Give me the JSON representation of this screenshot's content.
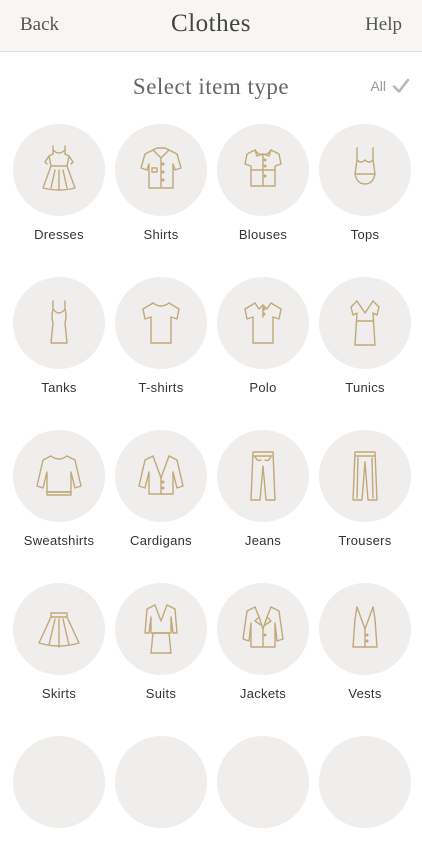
{
  "nav": {
    "back": "Back",
    "title": "Clothes",
    "help": "Help"
  },
  "header": {
    "title": "Select item type",
    "all_label": "All"
  },
  "items": [
    {
      "label": "Dresses",
      "icon": "dress-icon"
    },
    {
      "label": "Shirts",
      "icon": "shirt-icon"
    },
    {
      "label": "Blouses",
      "icon": "blouse-icon"
    },
    {
      "label": "Tops",
      "icon": "top-icon"
    },
    {
      "label": "Tanks",
      "icon": "tank-icon"
    },
    {
      "label": "T-shirts",
      "icon": "tshirt-icon"
    },
    {
      "label": "Polo",
      "icon": "polo-icon"
    },
    {
      "label": "Tunics",
      "icon": "tunic-icon"
    },
    {
      "label": "Sweatshirts",
      "icon": "sweatshirt-icon"
    },
    {
      "label": "Cardigans",
      "icon": "cardigan-icon"
    },
    {
      "label": "Jeans",
      "icon": "jeans-icon"
    },
    {
      "label": "Trousers",
      "icon": "trousers-icon"
    },
    {
      "label": "Skirts",
      "icon": "skirt-icon"
    },
    {
      "label": "Suits",
      "icon": "suit-icon"
    },
    {
      "label": "Jackets",
      "icon": "jacket-icon"
    },
    {
      "label": "Vests",
      "icon": "vest-icon"
    }
  ],
  "colors": {
    "icon_stroke": "#c2a878",
    "circle_bg": "#efeeec",
    "nav_bg": "#f7f6f3"
  }
}
